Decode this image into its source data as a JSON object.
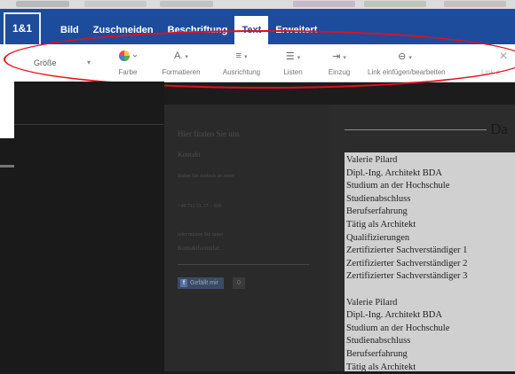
{
  "editor": {
    "logo": "1&1",
    "tabs": [
      {
        "label": "Bild",
        "active": false
      },
      {
        "label": "Zuschneiden",
        "active": false
      },
      {
        "label": "Beschriftung",
        "active": false
      },
      {
        "label": "Text",
        "active": true
      },
      {
        "label": "Erweitert",
        "active": false
      }
    ],
    "toolbar": {
      "size_label": "Größe",
      "farbe": "Farbe",
      "formatieren": "Formatieren",
      "ausrichtung": "Ausrichtung",
      "listen": "Listen",
      "einzug": "Einzug",
      "link": "Link einfügen/bearbeiten",
      "link_trunc": "Link e..."
    },
    "colors": {
      "ribbon_blue": "#1d4c9c",
      "annotation_red": "#e10f1f"
    }
  },
  "contact": {
    "heading": "Hier finden Sie uns",
    "kontakt": "Kontakt",
    "line1": "Rufen Sie einfach an unter",
    "phone": "+49 711 51 37 – 605",
    "line2": "oder nutzen Sie unser",
    "form": "Kontaktformular.",
    "like": "Gefällt mir",
    "like_count": "0"
  },
  "content": {
    "heading": "Da",
    "lines": [
      "Valerie Pilard",
      "Dipl.-Ing. Architekt BDA",
      "Studium an der Hochschule",
      "Studienabschluss",
      "Berufserfahrung",
      "Tätig als Architekt",
      "Qualifizierungen",
      "Zertifizierter Sachverständiger 1",
      "Zertifizierter Sachverständiger 2",
      "Zertifizierter Sachverständiger 3",
      "",
      "Valerie Pilard",
      "Dipl.-Ing. Architekt BDA",
      "Studium an der Hochschule",
      "Studienabschluss",
      "Berufserfahrung",
      "Tätig als Architekt"
    ]
  }
}
